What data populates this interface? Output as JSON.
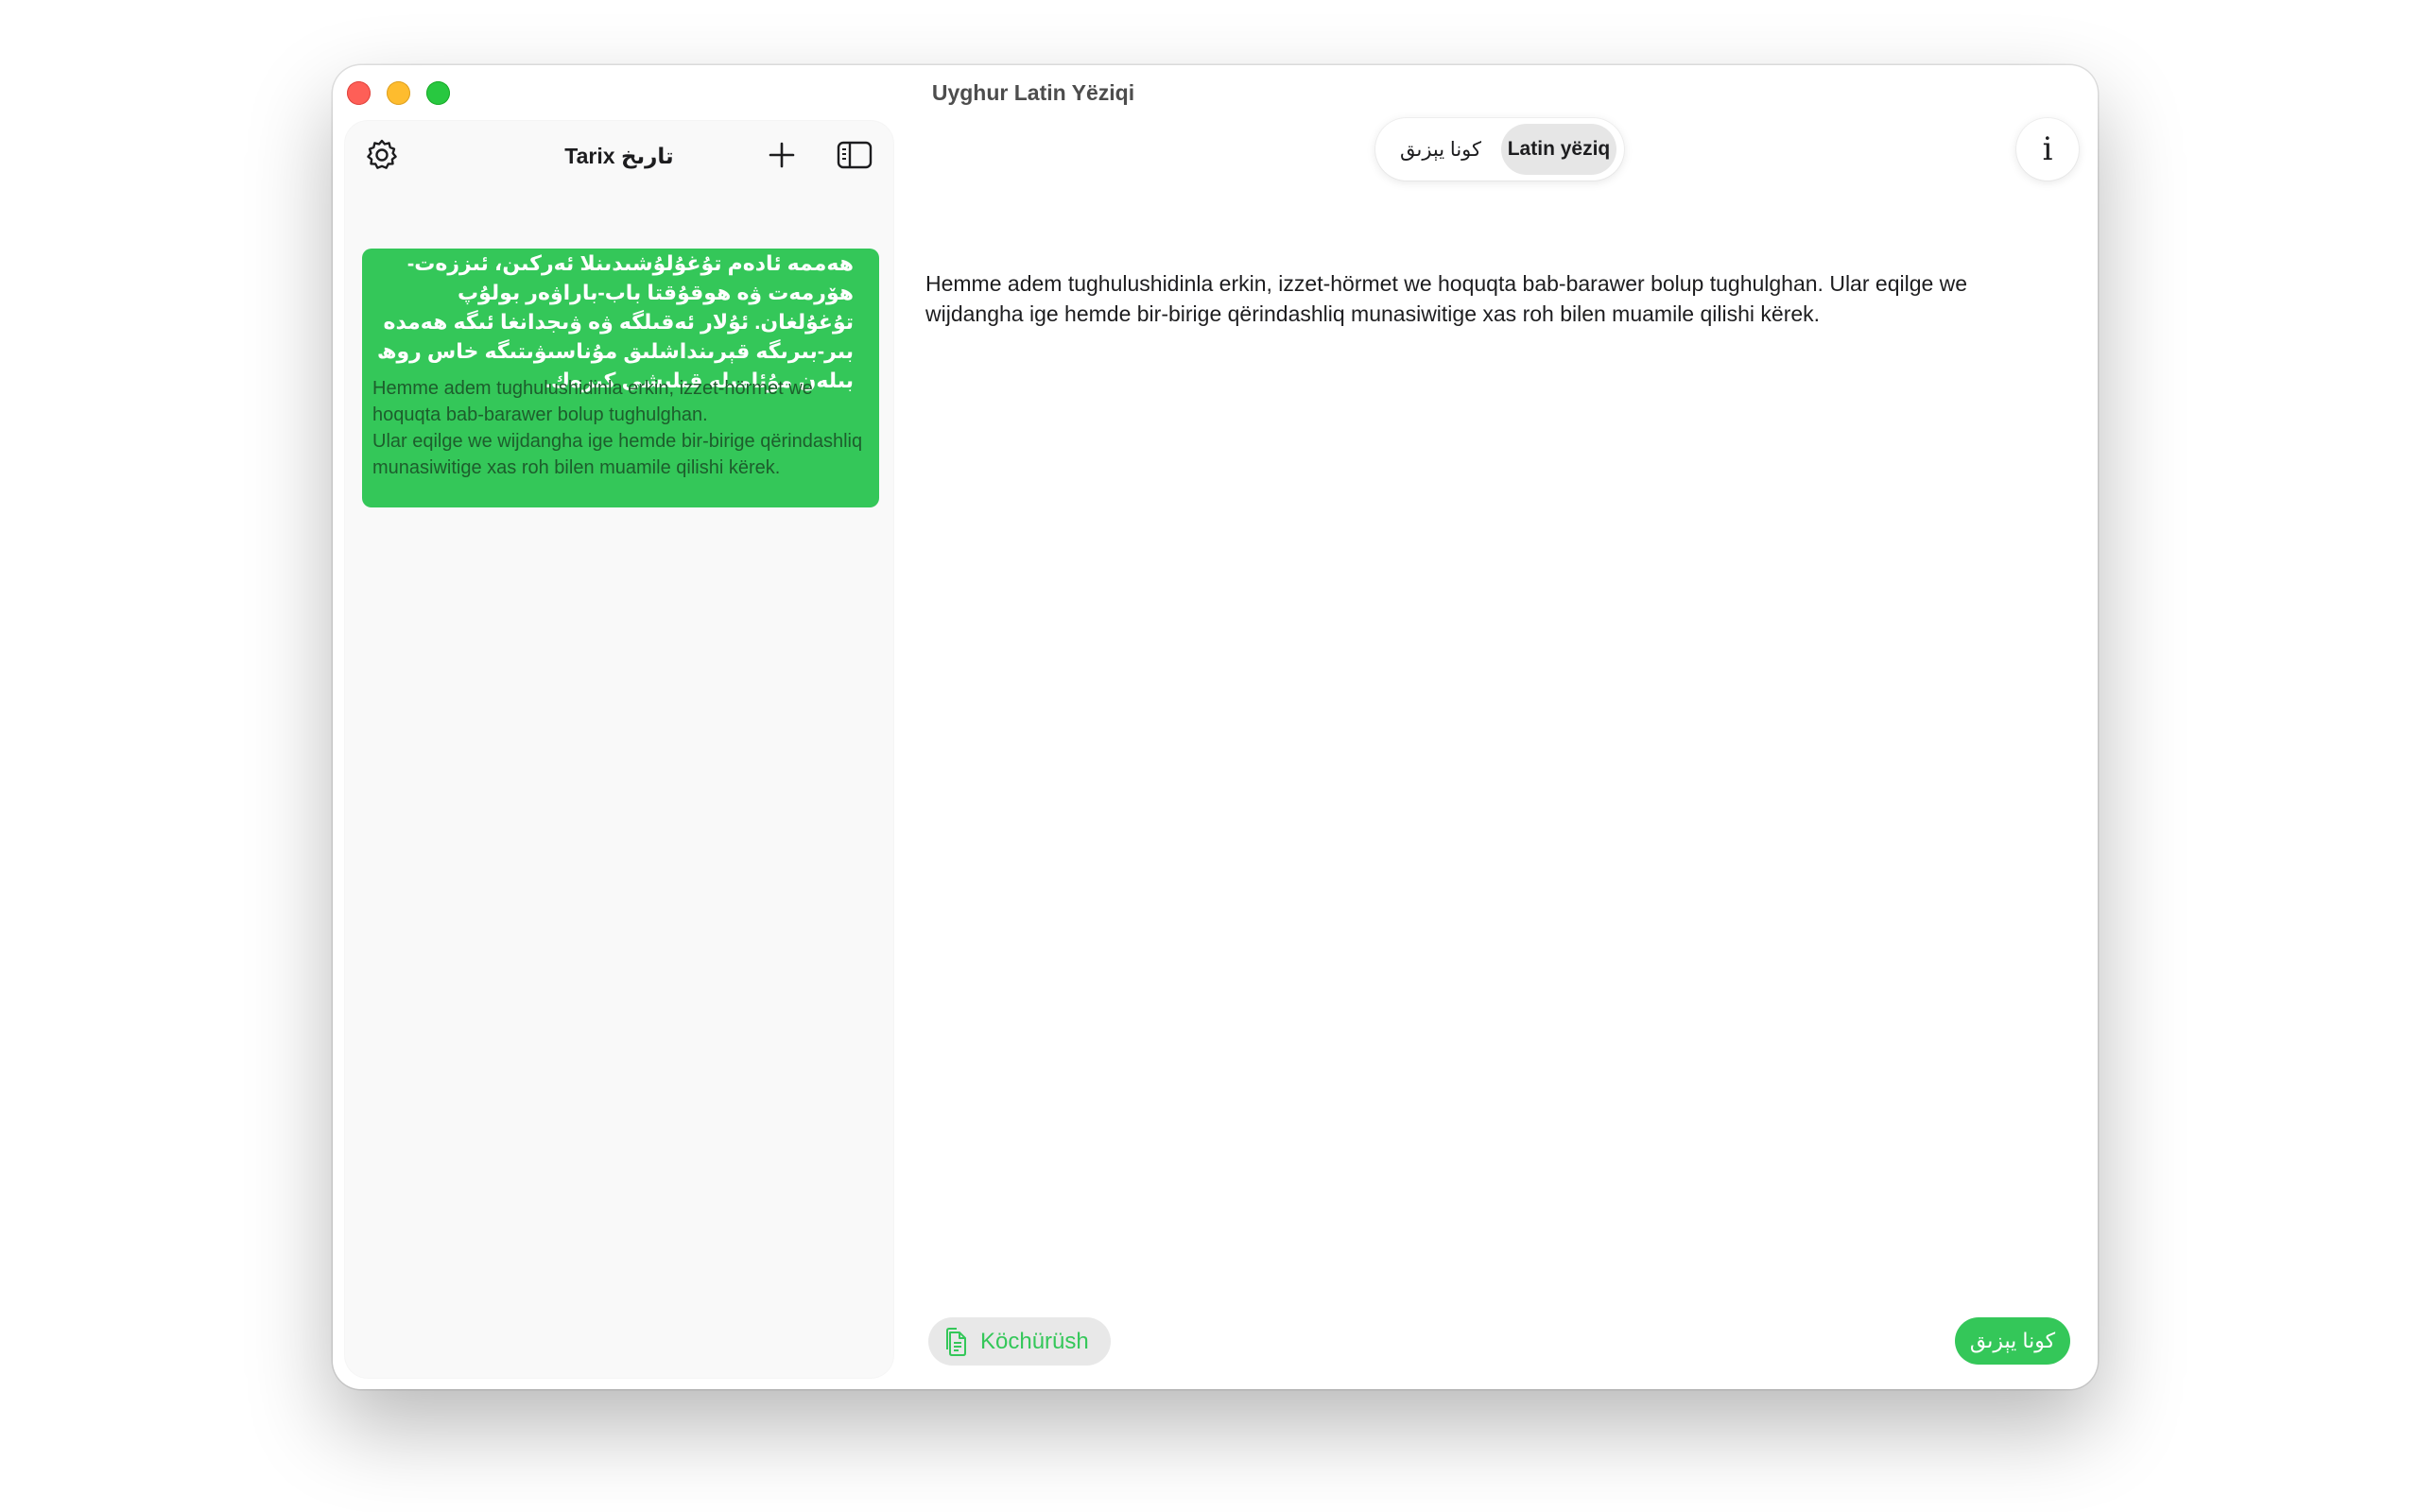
{
  "window": {
    "title": "Uyghur Latin Yëziqi"
  },
  "sidebar": {
    "title": "Tarix  تارىخ",
    "settings_icon": "gear-icon",
    "add_icon": "plus-icon",
    "toggle_icon": "sidebar-icon",
    "history": [
      {
        "arabic": "ھەممە ئادەم تۇغۇلۇشىدىنلا ئەركىن، ئىززەت-ھۆرمەت ۋە ھوقۇقتا باب-باراۋەر بولۇپ تۇغۇلغان. ئۇلار ئەقىلگە ۋە ۋىجدانغا ئىگە ھەمدە بىر-بىرىگە قېرىنداشلىق مۇناسىۋىتىگە خاس روھ بىلەن مۇئامىلە قىلىشى كېرەك.",
        "latin": "Hemme adem tughulushidinla erkin, izzet-hörmet we hoquqta bab-barawer bolup tughulghan.\nUlar eqilge we wijdangha ige hemde bir-birige qërindashliq munasiwitige xas roh bilen muamile qilishi kërek."
      }
    ]
  },
  "segmented": {
    "old_label": "كونا يېزىق",
    "latin_label": "Latin yëziq",
    "selected": "Latin yëziq"
  },
  "info_button": {
    "label": "i"
  },
  "main": {
    "text": "Hemme adem tughulushidinla erkin, izzet-hörmet we hoquqta bab-barawer bolup tughulghan. Ular eqilge we wijdangha ige hemde bir-birige qërindashliq munasiwitige xas roh bilen muamile qilishi kërek."
  },
  "footer": {
    "copy_label": "Köchürüsh",
    "copy_icon": "document-copy-icon",
    "convert_label": "كونا يېزىق"
  },
  "colors": {
    "accent": "#34c759",
    "close": "#fe5f57",
    "minimize": "#febc2e",
    "maximize": "#28c840"
  }
}
